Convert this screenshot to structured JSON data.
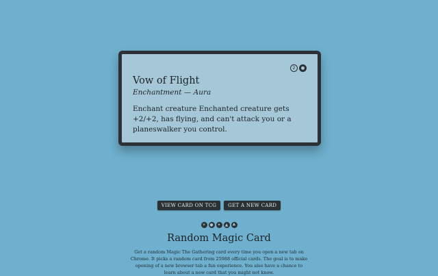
{
  "card": {
    "name": "Vow of Flight",
    "type_line": "Enchantment — Aura",
    "text": "Enchant creature Enchanted creature gets +2/+2, has flying, and can't attack you or a planeswalker you control.",
    "mana_cost": [
      {
        "symbol": "2",
        "icon": "generic-mana-2-icon"
      },
      {
        "symbol": "💧",
        "icon": "blue-mana-icon"
      }
    ]
  },
  "buttons": {
    "view_tcg": "VIEW CARD ON TCG",
    "new_card": "GET A NEW CARD"
  },
  "color_symbols": [
    {
      "icon": "white-mana-icon",
      "glyph": "☀"
    },
    {
      "icon": "blue-mana-icon",
      "glyph": "💧"
    },
    {
      "icon": "black-mana-icon",
      "glyph": "☠"
    },
    {
      "icon": "red-mana-icon",
      "glyph": "🔥"
    },
    {
      "icon": "green-mana-icon",
      "glyph": "🌲"
    }
  ],
  "app": {
    "title": "Random Magic Card",
    "description": "Get a random Magic The Gathering card every time you open a new tab on Chrome. It picks a random card from 25988 official cards. The goal is to make opening of a new browser tab a fun experience. You also have a chance to learn about a new card that you might not know."
  },
  "colors": {
    "background": "#6eb0cd",
    "card_fill": "#a5c7d8",
    "card_border": "#2b3134",
    "button": "#2b3236"
  }
}
